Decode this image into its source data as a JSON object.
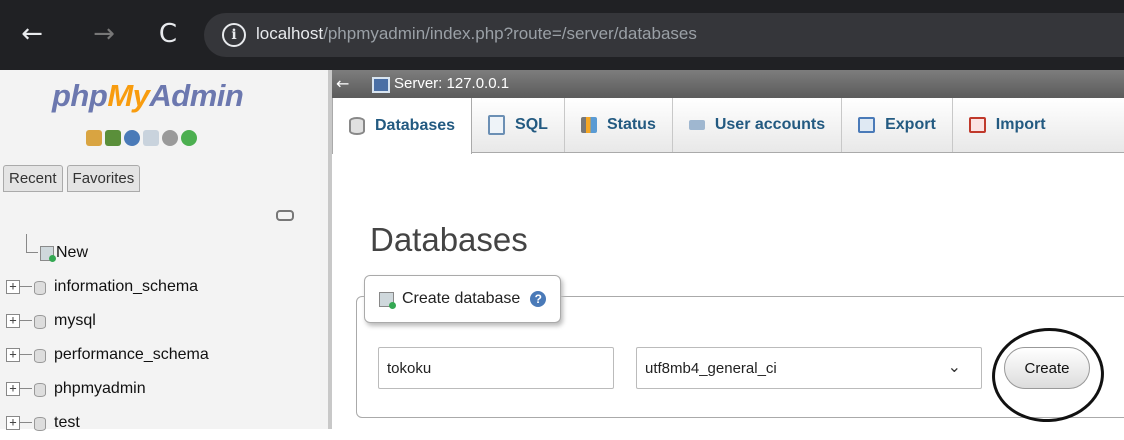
{
  "browser": {
    "back_glyph": "←",
    "forward_glyph": "→",
    "reload_glyph": "C",
    "info_glyph": "i",
    "url_host": "localhost",
    "url_path": "/phpmyadmin/index.php?route=/server/databases"
  },
  "sidebar": {
    "logo": {
      "php": "php",
      "my": "My",
      "admin": "Admin"
    },
    "toolbar_icons": [
      "home-icon",
      "database-icon",
      "query-icon",
      "docs-icon",
      "settings-icon",
      "reload-icon"
    ],
    "tabs": [
      "Recent",
      "Favorites"
    ],
    "tree": {
      "new_label": "New",
      "databases": [
        "information_schema",
        "mysql",
        "performance_schema",
        "phpmyadmin",
        "test"
      ],
      "expander_glyph": "+"
    }
  },
  "main": {
    "collapse_glyph": "←",
    "server_label": "Server: 127.0.0.1",
    "tabs": [
      {
        "label": "Databases",
        "icon": "database-icon"
      },
      {
        "label": "SQL",
        "icon": "sql-icon"
      },
      {
        "label": "Status",
        "icon": "status-icon"
      },
      {
        "label": "User accounts",
        "icon": "users-icon"
      },
      {
        "label": "Export",
        "icon": "export-icon"
      },
      {
        "label": "Import",
        "icon": "import-icon"
      }
    ],
    "page_title": "Databases",
    "create_db": {
      "legend": "Create database",
      "help_glyph": "?",
      "name_value": "tokoku",
      "collation_value": "utf8mb4_general_ci",
      "chevron_glyph": "⌄",
      "button_label": "Create"
    }
  },
  "colors": {
    "accent": "#235a81",
    "logo_blue": "#6c78af",
    "logo_orange": "#f89c0e"
  }
}
